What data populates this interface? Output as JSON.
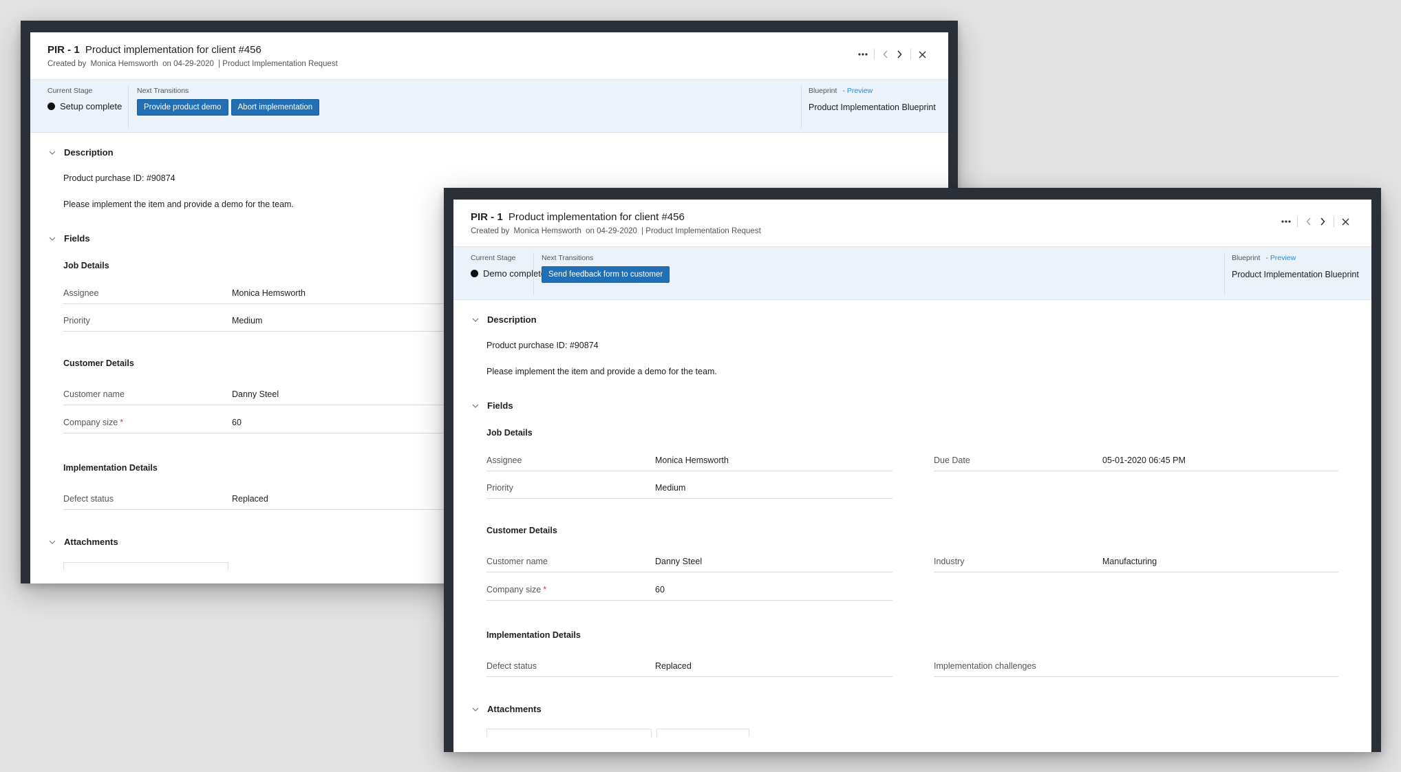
{
  "windowA": {
    "title_id": "PIR - 1",
    "title_text": "Product implementation for client #456",
    "created_by_label": "Created by",
    "created_by": "Monica Hemsworth",
    "created_on": "on 04-29-2020",
    "record_type": "| Product Implementation Request",
    "current_stage_label": "Current Stage",
    "current_stage": "Setup complete",
    "next_transitions_label": "Next Transitions",
    "transitions": [
      "Provide product demo",
      "Abort implementation"
    ],
    "blueprint_label": "Blueprint",
    "blueprint_link": "- Preview",
    "blueprint_name": "Product Implementation Blueprint",
    "description_label": "Description",
    "desc_line1": "Product purchase ID: #90874",
    "desc_line2": "Please implement the item and provide a demo for the team.",
    "fields_label": "Fields",
    "job_details_label": "Job Details",
    "assignee_label": "Assignee",
    "assignee": "Monica Hemsworth",
    "priority_label": "Priority",
    "priority": "Medium",
    "customer_details_label": "Customer Details",
    "customer_name_label": "Customer name",
    "customer_name": "Danny Steel",
    "company_size_label": "Company size",
    "company_size": "60",
    "required_mark": "*",
    "impl_details_label": "Implementation Details",
    "defect_status_label": "Defect status",
    "defect_status": "Replaced",
    "attachments_label": "Attachments"
  },
  "windowB": {
    "title_id": "PIR - 1",
    "title_text": "Product implementation for client #456",
    "created_by_label": "Created by",
    "created_by": "Monica Hemsworth",
    "created_on": "on 04-29-2020",
    "record_type": "| Product Implementation Request",
    "current_stage_label": "Current Stage",
    "current_stage": "Demo complete",
    "next_transitions_label": "Next Transitions",
    "transitions": [
      "Send feedback form to customer"
    ],
    "blueprint_label": "Blueprint",
    "blueprint_link": "- Preview",
    "blueprint_name": "Product Implementation Blueprint",
    "description_label": "Description",
    "desc_line1": "Product purchase ID: #90874",
    "desc_line2": "Please implement the item and provide a demo for the team.",
    "fields_label": "Fields",
    "job_details_label": "Job Details",
    "assignee_label": "Assignee",
    "assignee": "Monica Hemsworth",
    "due_date_label": "Due Date",
    "due_date": "05-01-2020 06:45 PM",
    "priority_label": "Priority",
    "priority": "Medium",
    "customer_details_label": "Customer Details",
    "customer_name_label": "Customer name",
    "customer_name": "Danny Steel",
    "industry_label": "Industry",
    "industry": "Manufacturing",
    "company_size_label": "Company size",
    "company_size": "60",
    "required_mark": "*",
    "impl_details_label": "Implementation Details",
    "defect_status_label": "Defect status",
    "defect_status": "Replaced",
    "impl_challenges_label": "Implementation challenges",
    "attachments_label": "Attachments"
  },
  "icons": {
    "more": "more-horizontal-icon",
    "prev": "chevron-left-icon",
    "next": "chevron-right-icon",
    "close": "close-icon",
    "collapse": "chevron-down-icon"
  },
  "colors": {
    "accent": "#2170b6",
    "band": "#ebf2fa",
    "link": "#2a8ad8",
    "frame": "#2b2f38",
    "required": "#d9363e"
  }
}
